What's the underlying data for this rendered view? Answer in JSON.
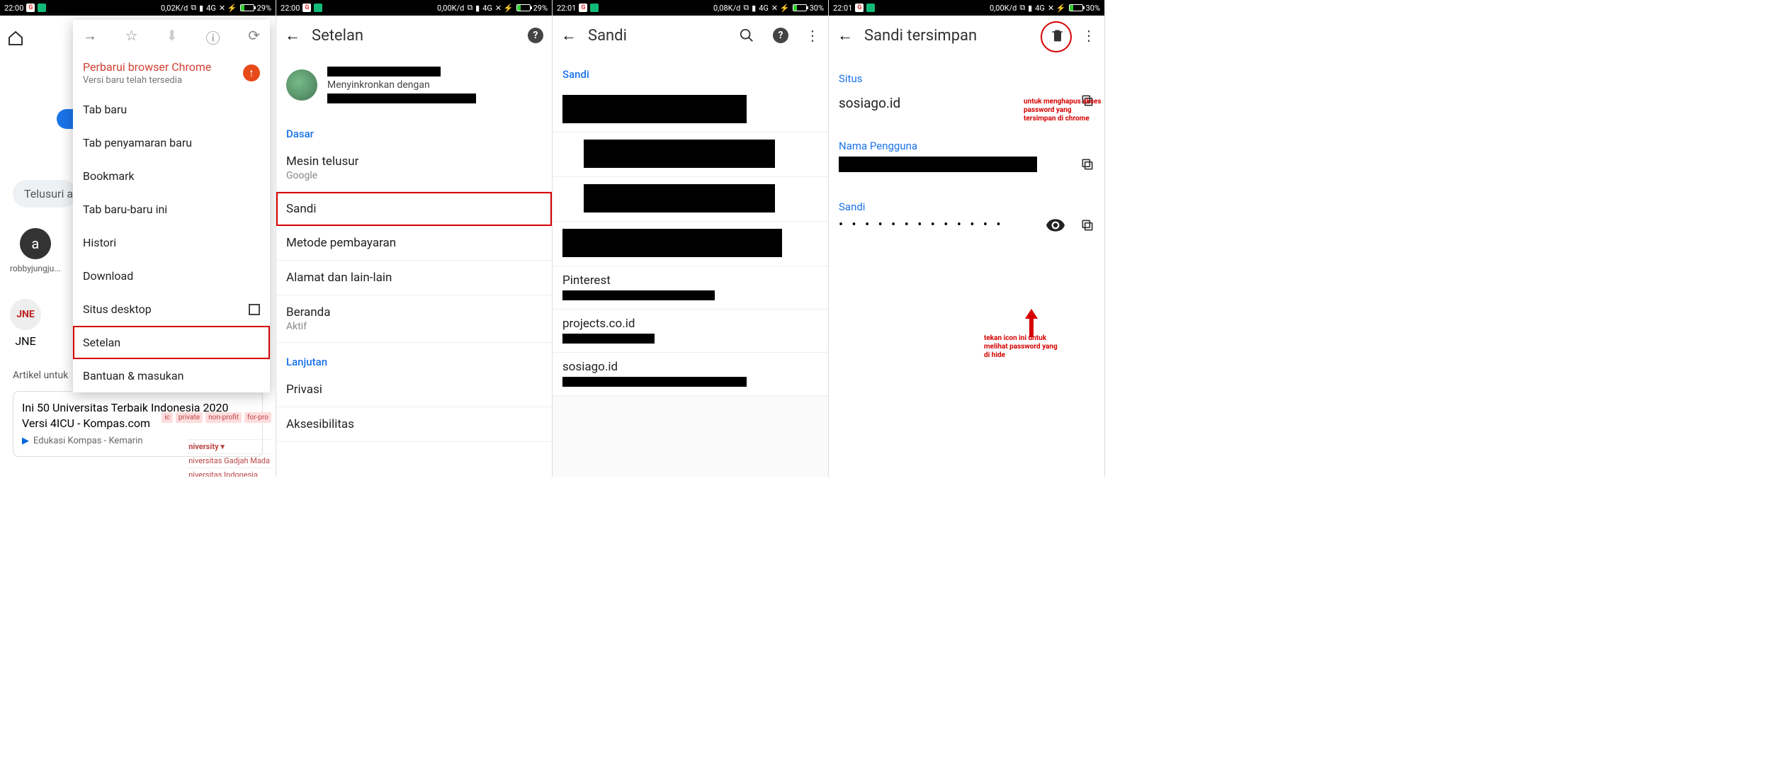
{
  "status": {
    "s1": {
      "time": "22:00",
      "data": "0,02K/d",
      "net": "4G",
      "batt": "29%"
    },
    "s2": {
      "time": "22:00",
      "data": "0,00K/d",
      "net": "4G",
      "batt": "29%"
    },
    "s3": {
      "time": "22:01",
      "data": "0,08K/d",
      "net": "4G",
      "batt": "30%"
    },
    "s4": {
      "time": "22:01",
      "data": "0,00K/d",
      "net": "4G",
      "batt": "30%"
    }
  },
  "screen1": {
    "search_hint": "Telusuri a",
    "quick_a_label": "robbyjungju...",
    "jne_label": "JNE",
    "jne_text": "JNE",
    "article_header": "Artikel untuk",
    "card_title": "Ini 50 Universitas Terbaik Indonesia 2020 Versi 4ICU - Kompas.com",
    "card_source": "Edukasi Kompas - Kemarin",
    "tags": [
      "ic",
      "private",
      "non-profit",
      "for-pro"
    ],
    "uni_header": "niversity ▾",
    "uni_items": [
      "niversitas Gadjah Mada",
      "niversitas Indonesia"
    ],
    "menu": {
      "update_title": "Perbarui browser Chrome",
      "update_sub": "Versi baru telah tersedia",
      "items": [
        "Tab baru",
        "Tab penyamaran baru",
        "Bookmark",
        "Tab baru-baru ini",
        "Histori",
        "Download",
        "Situs desktop",
        "Setelan",
        "Bantuan & masukan"
      ]
    }
  },
  "screen2": {
    "title": "Setelan",
    "sync_text": "Menyinkronkan dengan",
    "section_basic": "Dasar",
    "items_basic": [
      {
        "t": "Mesin telusur",
        "s": "Google"
      },
      {
        "t": "Sandi",
        "s": ""
      },
      {
        "t": "Metode pembayaran",
        "s": ""
      },
      {
        "t": "Alamat dan lain-lain",
        "s": ""
      },
      {
        "t": "Beranda",
        "s": "Aktif"
      }
    ],
    "section_adv": "Lanjutan",
    "items_adv": [
      "Privasi",
      "Aksesibilitas"
    ]
  },
  "screen3": {
    "title": "Sandi",
    "section": "Sandi",
    "rows": [
      {
        "site": "",
        "rw": 260
      },
      {
        "site": "",
        "rw": 270,
        "prefix": true
      },
      {
        "site": "",
        "rw": 270,
        "prefix": true
      },
      {
        "site": "",
        "rw": 310
      },
      {
        "site": "Pinterest",
        "rw": 215
      },
      {
        "site": "projects.co.id",
        "rw": 130
      },
      {
        "site": "sosiago.id",
        "rw": 260
      }
    ]
  },
  "screen4": {
    "title": "Sandi tersimpan",
    "note_delete": "untuk menghapus akses password yang tersimpan di chrome",
    "label_site": "Situs",
    "val_site": "sosiago.id",
    "label_user": "Nama Pengguna",
    "label_pass": "Sandi",
    "dots": "• • • • • • • • • • • • •",
    "note_eye": "tekan icon ini untuk melihat password yang di hide"
  }
}
